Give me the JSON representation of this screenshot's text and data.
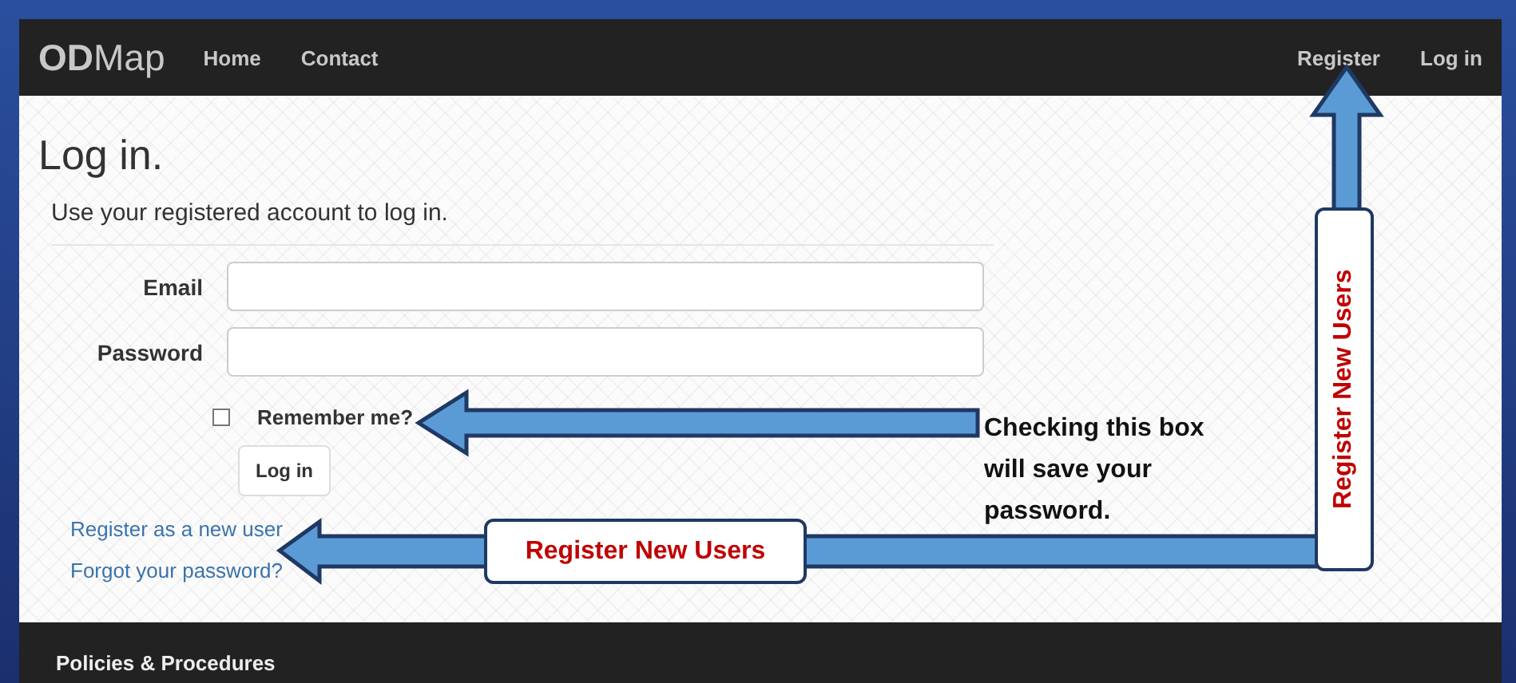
{
  "navbar": {
    "brand": "**OD**Map",
    "left_links": [
      "Home",
      "Contact"
    ],
    "right_links": [
      "Register",
      "Log in"
    ]
  },
  "login": {
    "title": "Log in.",
    "subtitle": "Use your registered account to log in.",
    "fields": [
      {
        "label": "Email"
      },
      {
        "label": "Password"
      }
    ],
    "remember": {
      "label": "Remember me?",
      "checked": false
    },
    "button": "Log in",
    "links": [
      "Register as a new user",
      "Forgot your password?"
    ]
  },
  "annotations": [
    {
      "kind": "note",
      "text": "Checking this box will save your password."
    },
    {
      "kind": "horizontal",
      "text": "Register New Users"
    },
    {
      "kind": "vertical",
      "text": "Register New Users"
    }
  ],
  "footer": {
    "text": "Policies & Procedures"
  }
}
